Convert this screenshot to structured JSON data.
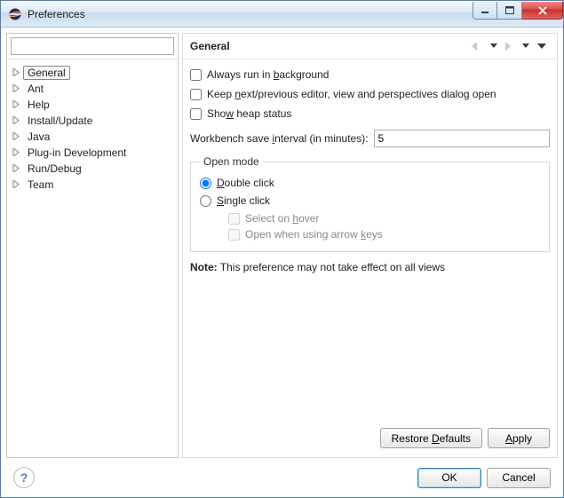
{
  "window": {
    "title": "Preferences"
  },
  "sidebar": {
    "filter_placeholder": "",
    "items": [
      {
        "label": "General",
        "selected": true
      },
      {
        "label": "Ant"
      },
      {
        "label": "Help"
      },
      {
        "label": "Install/Update"
      },
      {
        "label": "Java"
      },
      {
        "label": "Plug-in Development"
      },
      {
        "label": "Run/Debug"
      },
      {
        "label": "Team"
      }
    ]
  },
  "page": {
    "title": "General",
    "always_run_bg": {
      "label_pre": "Always run in ",
      "mn": "b",
      "label_post": "ackground",
      "checked": false
    },
    "keep_editors": {
      "label_pre": "Keep ",
      "mn": "n",
      "label_post": "ext/previous editor, view and perspectives dialog open",
      "checked": false
    },
    "show_heap": {
      "label_pre": "Sho",
      "mn": "w",
      "label_post": " heap status",
      "checked": false
    },
    "save_interval": {
      "label_pre": "Workbench save ",
      "mn": "i",
      "label_post": "nterval (in minutes):",
      "value": "5"
    },
    "open_mode": {
      "legend": "Open mode",
      "double": {
        "mn": "D",
        "label_post": "ouble click",
        "checked": true
      },
      "single": {
        "mn": "S",
        "label_post": "ingle click",
        "checked": false
      },
      "select_hover": {
        "label_pre": "Select on ",
        "mn": "h",
        "label_post": "over",
        "checked": false,
        "disabled": true
      },
      "arrow_keys": {
        "label_pre": "Open when using arrow ",
        "mn": "k",
        "label_post": "eys",
        "checked": false,
        "disabled": true
      }
    },
    "note_label": "Note:",
    "note_text": " This preference may not take effect on all views"
  },
  "buttons": {
    "restore": {
      "pre": "Restore ",
      "mn": "D",
      "post": "efaults"
    },
    "apply": {
      "mn": "A",
      "post": "pply"
    },
    "ok": "OK",
    "cancel": "Cancel",
    "help": "?"
  }
}
